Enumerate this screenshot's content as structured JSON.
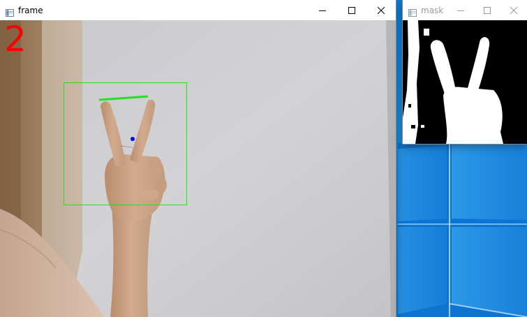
{
  "frame_window": {
    "title": "frame",
    "finger_count": "2",
    "controls": [
      "minimize",
      "maximize",
      "close"
    ]
  },
  "mask_window": {
    "title": "mask",
    "controls": [
      "minimize",
      "maximize",
      "close"
    ]
  },
  "colors": {
    "detection_box": "#22e022",
    "finger_count": "#ff0000",
    "centroid": "#0000ff",
    "desktop": "#0a7fd8"
  },
  "icons": [
    "app-icon",
    "minimize-icon",
    "maximize-icon",
    "close-icon",
    "windows-logo"
  ]
}
